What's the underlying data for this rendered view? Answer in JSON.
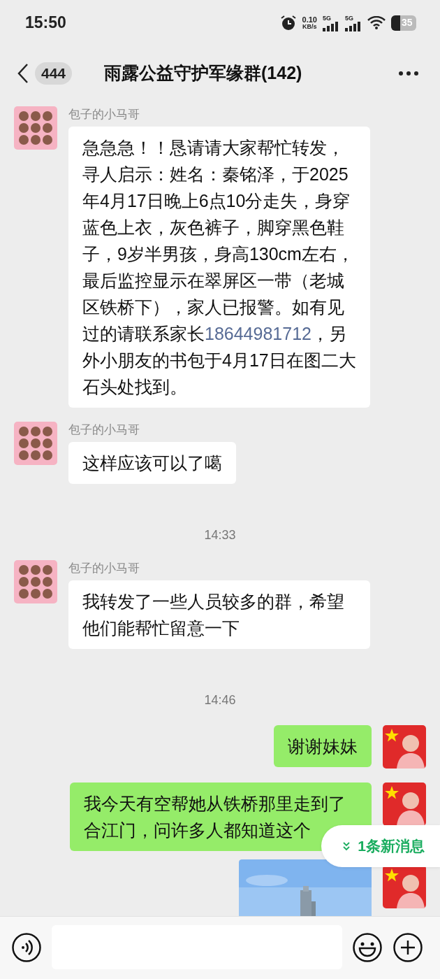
{
  "status_bar": {
    "time": "15:50",
    "net_speed": "0.10",
    "net_unit": "KB/s",
    "sim_1": "5G",
    "sim_2": "5G",
    "battery": "35"
  },
  "header": {
    "unread": "444",
    "title": "雨露公益守护军缘群(142)"
  },
  "messages": [
    {
      "kind": "incoming_text",
      "sender": "包子的小马哥",
      "segments": [
        {
          "kind": "text",
          "text": "急急急！！恳请请大家帮忙转发，寻人启示：姓名：秦铭泽，于2025年4月17日晚上6点10分走失，身穿蓝色上衣，灰色裤子，脚穿黑色鞋子，9岁半男孩，身高130cm左右，最后监控显示在翠屏区一带（老城区铁桥下），家人已报警。如有见过的请联系家长"
        },
        {
          "kind": "link",
          "text": "18644981712"
        },
        {
          "kind": "text",
          "text": "，另外小朋友的书包于4月17日在图二大石头处找到。"
        }
      ]
    },
    {
      "kind": "incoming_text",
      "sender": "包子的小马哥",
      "segments": [
        {
          "kind": "text",
          "text": "这样应该可以了噶"
        }
      ]
    },
    {
      "kind": "time",
      "text": "14:33"
    },
    {
      "kind": "incoming_text",
      "sender": "包子的小马哥",
      "segments": [
        {
          "kind": "text",
          "text": "我转发了一些人员较多的群，希望他们能帮忙留意一下"
        }
      ]
    },
    {
      "kind": "time",
      "text": "14:46"
    },
    {
      "kind": "outgoing_text",
      "segments": [
        {
          "kind": "text",
          "text": "谢谢妹妹"
        }
      ]
    },
    {
      "kind": "outgoing_text",
      "segments": [
        {
          "kind": "text",
          "text": "我今天有空帮她从铁桥那里走到了合江门，问许多人都知道这个"
        }
      ]
    },
    {
      "kind": "outgoing_image"
    }
  ],
  "new_messages": {
    "label": "1条新消息"
  }
}
